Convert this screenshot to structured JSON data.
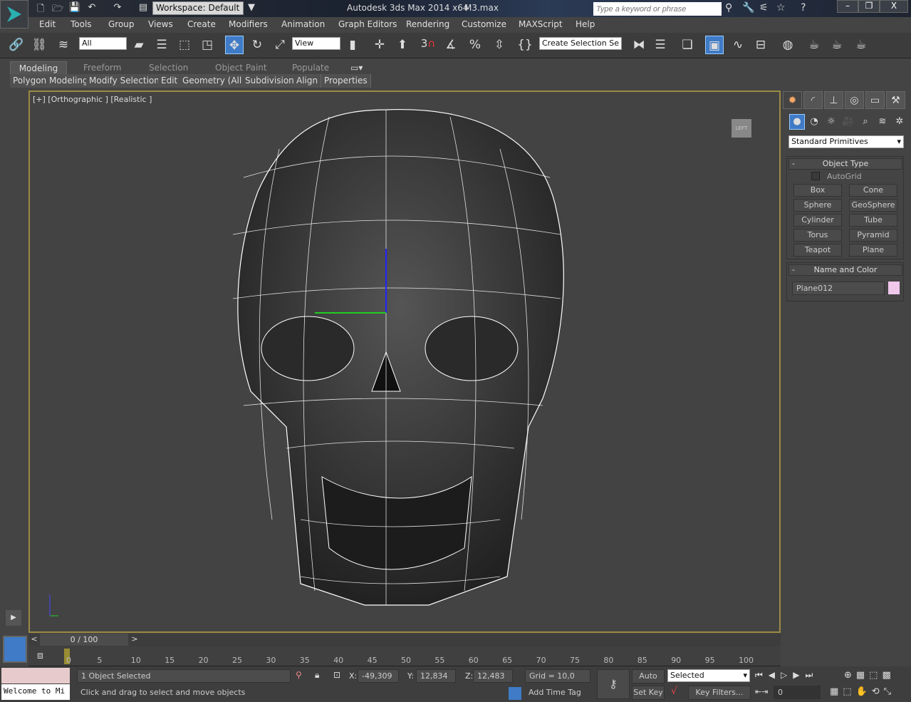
{
  "titlebar": {
    "workspace": "Workspace: Default",
    "app_title": "Autodesk 3ds Max  2014 x64",
    "file_name": "M3.max",
    "search_placeholder": "Type a keyword or phrase",
    "minimize": "–",
    "restore": "❐",
    "close": "X"
  },
  "menu": [
    "Edit",
    "Tools",
    "Group",
    "Views",
    "Create",
    "Modifiers",
    "Animation",
    "Graph Editors",
    "Rendering",
    "Customize",
    "MAXScript",
    "Help"
  ],
  "toolbar": {
    "selection_filter": "All",
    "reference_coord": "View",
    "snap_3d": "3",
    "named_selection": "Create Selection Se"
  },
  "ribbon": {
    "tabs": [
      "Modeling",
      "Freeform",
      "Selection",
      "Object Paint",
      "Populate"
    ],
    "subtabs": [
      "Polygon Modeling",
      "Modify Selection",
      "Edit",
      "Geometry (All)",
      "Subdivision",
      "Align",
      "Properties"
    ]
  },
  "viewport": {
    "label": "[+] [Orthographic ] [Realistic ]",
    "viewcube": "LEFT"
  },
  "command_panel": {
    "category": "Standard Primitives",
    "object_type_title": "Object Type",
    "autogrid": "AutoGrid",
    "buttons": [
      "Box",
      "Cone",
      "Sphere",
      "GeoSphere",
      "Cylinder",
      "Tube",
      "Torus",
      "Pyramid",
      "Teapot",
      "Plane"
    ],
    "name_color_title": "Name and Color",
    "object_name": "Plane012",
    "object_color": "#f0c8ec",
    "collapse": "-"
  },
  "timeline": {
    "frame": "0 / 100",
    "ticks": [
      "0",
      "5",
      "10",
      "15",
      "20",
      "25",
      "30",
      "35",
      "40",
      "45",
      "50",
      "55",
      "60",
      "65",
      "70",
      "75",
      "80",
      "85",
      "90",
      "95",
      "100"
    ]
  },
  "status": {
    "listener": "Welcome to Mi",
    "selected": "1 Object Selected",
    "prompt": "Click and drag to select and move objects",
    "x_label": "X:",
    "x": "-49,309",
    "y_label": "Y:",
    "y": "12,834",
    "z_label": "Z:",
    "z": "12,483",
    "grid": "Grid = 10,0",
    "add_time_tag": "Add Time Tag",
    "auto_key": "Auto Key",
    "set_key": "Set Key",
    "key_mode": "Selected",
    "key_filters": "Key Filters...",
    "current_frame": "0"
  }
}
